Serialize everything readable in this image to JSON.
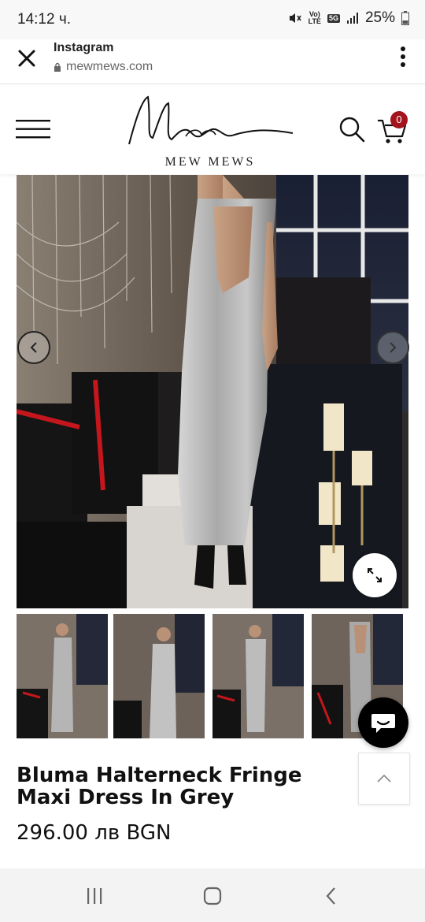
{
  "status_bar": {
    "time": "14:12 ч.",
    "volte_label": "Vo)\nLTE",
    "network": "5G",
    "battery_percent": "25%"
  },
  "browser": {
    "app_name": "Instagram",
    "url": "mewmews.com"
  },
  "site": {
    "brand_wordmark": "MEW MEWS",
    "cart_count": "0"
  },
  "product": {
    "title": "Bluma Halterneck Fringe Maxi Dress In Grey",
    "price": "296.00 лв BGN"
  },
  "gallery": {
    "thumbnail_count": 4,
    "selected_index": 3
  },
  "colors": {
    "badge": "#a3141e",
    "chat_bubble": "#000000"
  },
  "icons": [
    "close-icon",
    "lock-icon",
    "more-vert-icon",
    "hamburger-icon",
    "search-icon",
    "cart-icon",
    "chevron-left-icon",
    "chevron-right-icon",
    "expand-icon",
    "chat-icon",
    "chevron-up-icon",
    "recents-icon",
    "home-icon",
    "back-icon"
  ]
}
